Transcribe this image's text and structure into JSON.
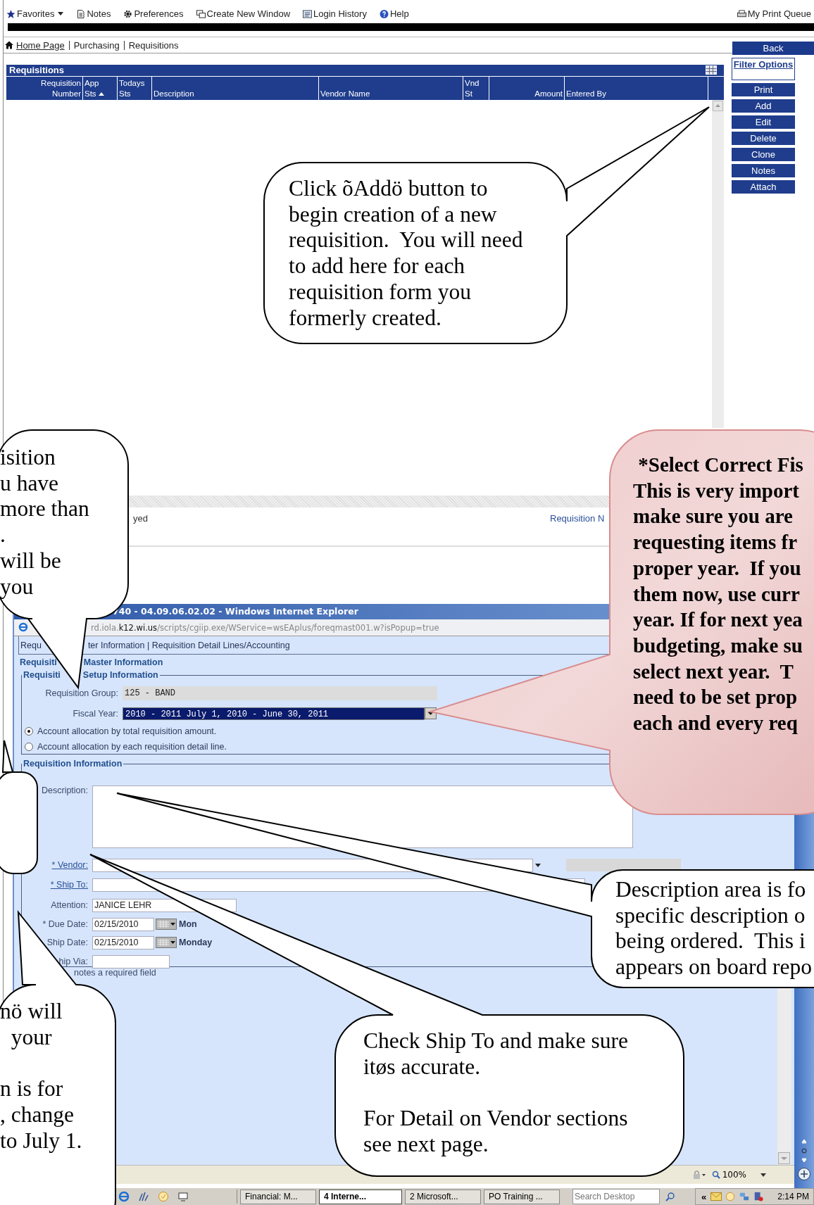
{
  "menu_bar": {
    "items": [
      "Favorites",
      "Notes",
      "Preferences",
      "Create New Window",
      "Login History",
      "Help"
    ],
    "print_queue": "My Print Queue"
  },
  "breadcrumb": {
    "items": [
      "Home Page",
      "Purchasing",
      "Requisitions"
    ],
    "back": "Back"
  },
  "requisitions": {
    "title": "Requisitions",
    "columns": [
      {
        "lines": [
          "Requisition",
          "Number"
        ],
        "sorted": false
      },
      {
        "lines": [
          "App",
          "Sts"
        ],
        "sorted": true
      },
      {
        "lines": [
          "Todays",
          "Sts"
        ],
        "sorted": false
      },
      {
        "lines": [
          "Description"
        ],
        "sorted": false
      },
      {
        "lines": [
          "Vendor Name"
        ],
        "sorted": false
      },
      {
        "lines": [
          "Vnd",
          "St"
        ],
        "sorted": false
      },
      {
        "lines": [
          "Amount"
        ],
        "sorted": false
      },
      {
        "lines": [
          "Entered By"
        ],
        "sorted": false
      }
    ],
    "actions": [
      {
        "kind": "link",
        "label": "Filter Options"
      },
      {
        "kind": "button",
        "label": "Print"
      },
      {
        "kind": "button",
        "label": "Add"
      },
      {
        "kind": "button",
        "label": "Edit"
      },
      {
        "kind": "button",
        "label": "Delete"
      },
      {
        "kind": "button",
        "label": "Clone"
      },
      {
        "kind": "button",
        "label": "Notes"
      },
      {
        "kind": "button",
        "label": "Attach"
      }
    ],
    "footer": [
      "yed",
      "Requisition N"
    ]
  },
  "popup": {
    "title": "740 - 04.09.06.02.02 - Windows Internet Explorer",
    "address": {
      "host_start": "rd.iola.",
      "domain": "k12.wi.us",
      "path": "/scripts/cgiip.exe/WService=wsEAplus/foreqmast001.w?isPopup=true"
    },
    "tab_line": [
      "Requ",
      "ter Information | Requisition Detail Lines/Accounting"
    ],
    "heading": [
      "Requisiti",
      "Master Information"
    ],
    "setup": {
      "legend": [
        "Requisiti",
        "Setup Information"
      ],
      "group": {
        "label": "Requisition Group:",
        "value": "125 - BAND"
      },
      "fiscal_year": {
        "label": "Fiscal Year:",
        "value": "2010 - 2011 July 1, 2010 - June 30, 2011"
      },
      "radios": [
        {
          "label": "Account allocation by total requisition amount.",
          "selected": true
        },
        {
          "label": "Account allocation by each requisition detail line.",
          "selected": false
        }
      ]
    },
    "info": {
      "legend": "Requisition Information",
      "fields": [
        {
          "kind": "textarea",
          "label": "Description:"
        },
        {
          "kind": "dropdown",
          "label": "* Vendor:"
        },
        {
          "kind": "lookup",
          "label": "* Ship To:"
        },
        {
          "kind": "text",
          "label": "Attention:",
          "value": "JANICE LEHR"
        },
        {
          "kind": "date",
          "label": "* Due Date:",
          "value": "02/15/2010",
          "weekday": "Mon"
        },
        {
          "kind": "date",
          "label": "Ship Date:",
          "value": "02/15/2010",
          "weekday": "Monday"
        },
        {
          "kind": "text",
          "label": "hip Via:"
        }
      ]
    },
    "note": "notes a required field",
    "status_zoom": "100%"
  },
  "taskbar": {
    "items": [
      {
        "label": "Financial: M...",
        "selected": false
      },
      {
        "label": "4 Interne...",
        "selected": true
      },
      {
        "label": "2 Microsoft...",
        "selected": false
      },
      {
        "label": "PO Training ...",
        "selected": false
      }
    ],
    "search_placeholder": "Search Desktop",
    "tray_toggle": "«",
    "clock": "2:14 PM"
  },
  "callouts": [
    {
      "kind": "note",
      "paragraphs": [
        [
          "Click õAddö button to",
          "begin creation of a new",
          "requisition.  You will need",
          "to add here for each",
          "requisition form you",
          "formerly created."
        ]
      ]
    },
    {
      "kind": "note",
      "paragraphs": [
        [
          "isition",
          "u have",
          "more than",
          ".",
          "will be",
          "you"
        ]
      ]
    },
    {
      "kind": "warning",
      "paragraphs": [
        [
          " *Select Correct Fis",
          "This is very import",
          "make sure you are",
          "requesting items fr",
          "proper year.  If you",
          "them now, use curr",
          "year. If for next yea",
          "budgeting, make su",
          "select next year.  T",
          "need to be set prop",
          "each and every req"
        ]
      ]
    },
    {
      "kind": "note",
      "paragraphs": [
        [
          "nö will",
          "  your"
        ],
        [
          "n is for",
          ", change",
          "to July 1."
        ]
      ]
    },
    {
      "kind": "note",
      "paragraphs": [
        [
          "Description area is fo",
          "specific description o",
          "being ordered.  This i",
          "appears on board repo"
        ]
      ]
    },
    {
      "kind": "note",
      "paragraphs": [
        [
          "Check Ship To and make sure",
          "itøs accurate."
        ],
        [
          "For Detail on Vendor sections",
          "see next page."
        ]
      ]
    }
  ]
}
